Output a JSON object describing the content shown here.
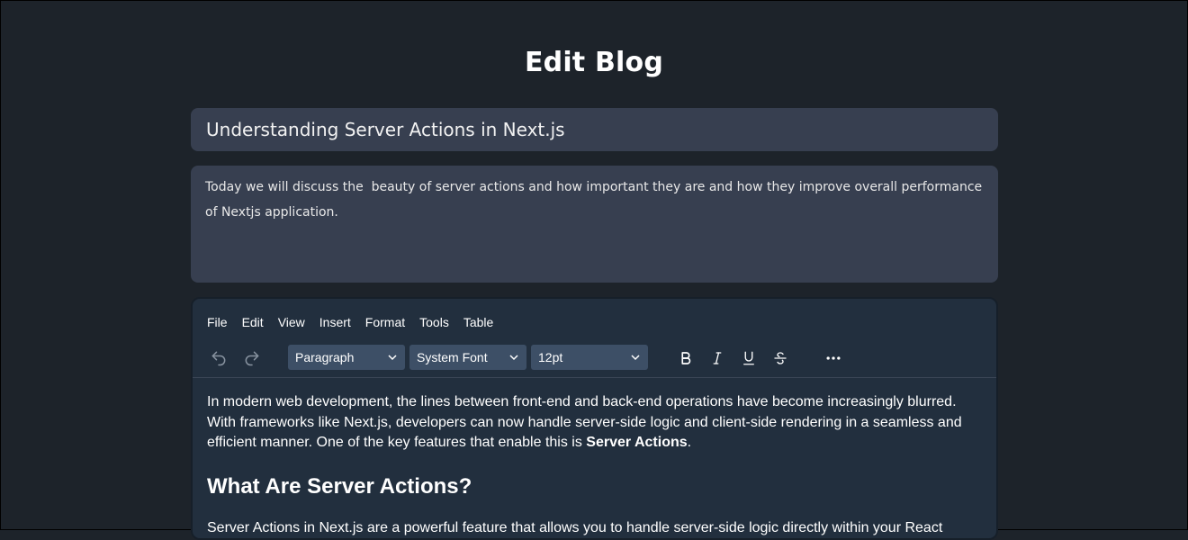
{
  "page": {
    "title": "Edit Blog"
  },
  "form": {
    "title_value": "Understanding Server Actions in Next.js",
    "description_value": "Today we will discuss the  beauty of server actions and how important they are and how they improve overall performance of Nextjs application."
  },
  "editor": {
    "menu": [
      "File",
      "Edit",
      "View",
      "Insert",
      "Format",
      "Tools",
      "Table"
    ],
    "toolbar": {
      "block_format": "Paragraph",
      "font_family": "System Font",
      "font_size": "12pt",
      "icons": [
        "undo-icon",
        "redo-icon",
        "bold-icon",
        "italic-icon",
        "underline-icon",
        "strikethrough-icon",
        "more-icon"
      ]
    },
    "content": {
      "paragraph1_text": "In modern web development, the lines between front-end and back-end operations have become increasingly blurred. With frameworks like Next.js, developers can now handle server-side logic and client-side rendering in a seamless and efficient manner. One of the key features that enable this is ",
      "paragraph1_bold": "Server Actions",
      "paragraph1_end": ".",
      "heading": "What Are Server Actions?",
      "paragraph2_text": "Server Actions in Next.js are a powerful feature that allows you to handle server-side logic directly within your React"
    }
  },
  "colors": {
    "background": "#1d232a",
    "input_bg": "#373f50",
    "editor_bg": "#222f3e",
    "select_bg": "#3d4f66"
  }
}
